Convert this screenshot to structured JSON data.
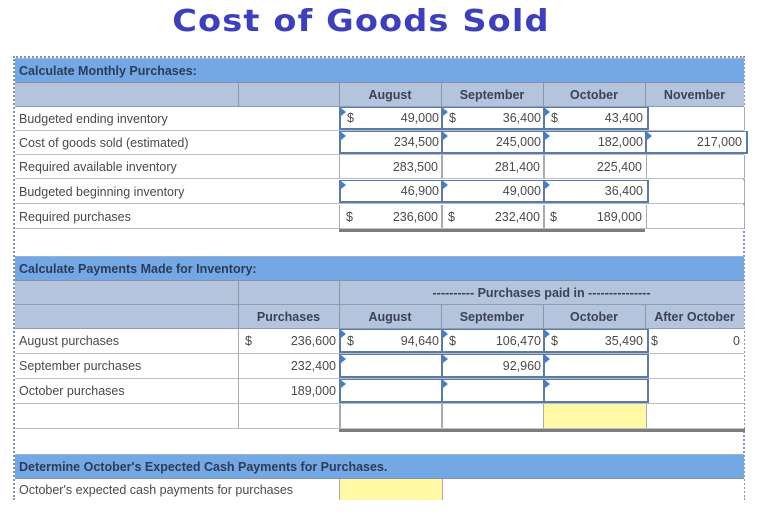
{
  "title": "Cost of Goods Sold",
  "section1": {
    "header": "Calculate Monthly Purchases:",
    "columns": [
      "August",
      "September",
      "October",
      "November"
    ],
    "rows": [
      {
        "label": "Budgeted ending inventory",
        "dollar": [
          true,
          true,
          true,
          false
        ],
        "values": [
          "49,000",
          "36,400",
          "43,400",
          ""
        ]
      },
      {
        "label": "Cost of goods sold (estimated)",
        "dollar": [
          false,
          false,
          false,
          false
        ],
        "values": [
          "234,500",
          "245,000",
          "182,000",
          "217,000"
        ]
      },
      {
        "label": "Required available inventory",
        "dollar": [
          false,
          false,
          false,
          false
        ],
        "values": [
          "283,500",
          "281,400",
          "225,400",
          ""
        ]
      },
      {
        "label": "Budgeted beginning inventory",
        "dollar": [
          false,
          false,
          false,
          false
        ],
        "values": [
          "46,900",
          "49,000",
          "36,400",
          ""
        ]
      },
      {
        "label": "Required purchases",
        "dollar": [
          true,
          true,
          true,
          false
        ],
        "values": [
          "236,600",
          "232,400",
          "189,000",
          ""
        ]
      }
    ]
  },
  "section2": {
    "header": "Calculate Payments Made for Inventory:",
    "group_header": "---------- Purchases paid in ---------------",
    "columns": [
      "Purchases",
      "August",
      "September",
      "October",
      "After October"
    ],
    "rows": [
      {
        "label": "August purchases",
        "purchases_dollar": true,
        "purchases": "236,600",
        "dollar": [
          true,
          true,
          true,
          true
        ],
        "values": [
          "94,640",
          "106,470",
          "35,490",
          "0"
        ]
      },
      {
        "label": "September purchases",
        "purchases_dollar": false,
        "purchases": "232,400",
        "dollar": [
          false,
          false,
          false,
          false
        ],
        "values": [
          "",
          "92,960",
          "",
          ""
        ]
      },
      {
        "label": "October purchases",
        "purchases_dollar": false,
        "purchases": "189,000",
        "dollar": [
          false,
          false,
          false,
          false
        ],
        "values": [
          "",
          "",
          "",
          ""
        ]
      },
      {
        "label": "",
        "purchases_dollar": false,
        "purchases": "",
        "dollar": [
          false,
          false,
          false,
          false
        ],
        "values": [
          "",
          "",
          "",
          ""
        ]
      }
    ]
  },
  "section3": {
    "header": "Determine October's Expected Cash Payments for Purchases.",
    "row_label": "October's expected cash payments for purchases",
    "value": ""
  },
  "colors": {
    "title": "#3c40bf",
    "section_bar": "#74a8e4",
    "column_header": "#b5c4dd",
    "highlight": "#fff9a6",
    "input_border": "#5a7aa8"
  }
}
